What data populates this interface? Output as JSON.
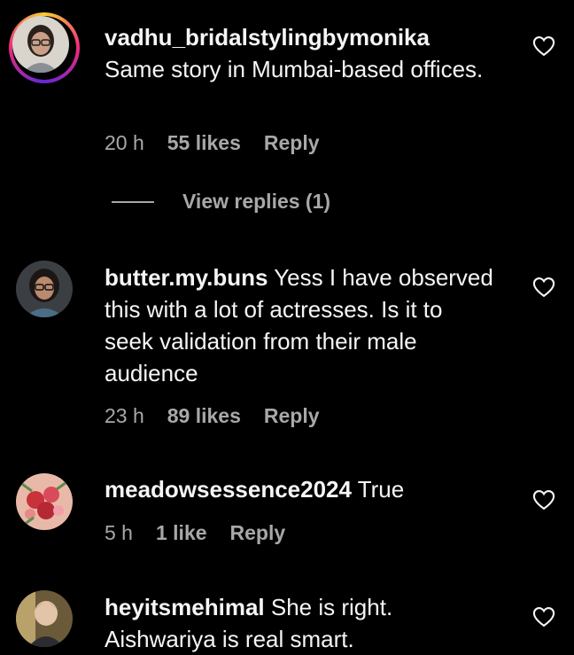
{
  "comments": [
    {
      "username": "vadhu_bridalstylingbymonika",
      "text": "Same story in Mumbai-based offices.",
      "time": "20 h",
      "likes": "55 likes",
      "reply": "Reply",
      "view_replies": "View replies (1)",
      "avatar_icon": "user-photo-icon"
    },
    {
      "username": "butter.my.buns",
      "text": "Yess I have observed this with a lot of actresses. Is it to seek validation from their male audience",
      "time": "23 h",
      "likes": "89 likes",
      "reply": "Reply",
      "avatar_icon": "user-photo-icon"
    },
    {
      "username": "meadowsessence2024",
      "text": "True",
      "time": "5 h",
      "likes": "1 like",
      "reply": "Reply",
      "avatar_icon": "flower-photo-icon"
    },
    {
      "username": "heyitsmehimal",
      "text": "She is right. Aishwariya is real smart.",
      "avatar_icon": "child-photo-icon"
    }
  ],
  "icons": {
    "like": "heart-outline-icon"
  },
  "colors": {
    "background": "#000000",
    "text": "#f5f5f5",
    "muted": "#a8a8a8"
  }
}
